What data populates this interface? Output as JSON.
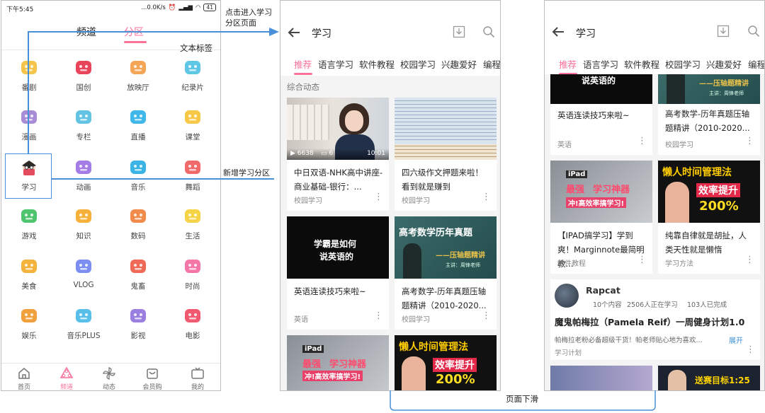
{
  "annotations": {
    "enter_line1": "点击进入学习",
    "enter_line2": "分区页面",
    "text_tag": "文本标签",
    "new_partition": "新增学习分区",
    "scroll_down": "页面下滑"
  },
  "phone1": {
    "status": {
      "time": "下午5:45",
      "net": "...0.0K/s",
      "battery": "41"
    },
    "tabs": [
      "频道",
      "分区"
    ],
    "grid": [
      "番剧",
      "国创",
      "放映厅",
      "纪录片",
      "漫画",
      "专栏",
      "直播",
      "课堂",
      "学习",
      "动画",
      "音乐",
      "舞蹈",
      "游戏",
      "知识",
      "数码",
      "生活",
      "美食",
      "VLOG",
      "鬼畜",
      "时尚",
      "娱乐",
      "音乐PLUS",
      "影视",
      "电影"
    ],
    "bottom_nav": [
      "首页",
      "频道",
      "动态",
      "会员购",
      "我的"
    ]
  },
  "phone2": {
    "title": "学习",
    "tabs": [
      "推荐",
      "语言学习",
      "软件教程",
      "校园学习",
      "兴趣爱好",
      "编程"
    ],
    "section": "综合动态",
    "cards": [
      {
        "title": "中日双语-NHK高中讲座-商业基础-银行：...",
        "tag": "校园学习",
        "views": "6638",
        "danmaku": "6",
        "duration": "10:01"
      },
      {
        "title": "四六级作文押题来啦！看到就是赚到",
        "tag": "校园学习"
      },
      {
        "title": "英语连读技巧来啦~",
        "tag": "英语",
        "thumb_l1": "学霸是如何",
        "thumb_l2": "说英语的"
      },
      {
        "title": "高考数学-历年真题压轴题精讲（2010-2020...",
        "tag": "校园学习",
        "thumb_l1": "高考数学历年真题",
        "thumb_l2": "——压轴题精讲",
        "thumb_l3": "主讲：周锋老师"
      },
      {
        "thumb_l1": "iPad",
        "thumb_l2": "最强",
        "thumb_l3": "学习神器",
        "thumb_l4": "冲!高效率搞学习!"
      },
      {
        "thumb_l1": "懒人时间管理法",
        "thumb_l2": "效率提升",
        "thumb_l3": "200%"
      }
    ]
  },
  "phone3": {
    "title": "学习",
    "tabs": [
      "推荐",
      "语言学习",
      "软件教程",
      "校园学习",
      "兴趣爱好",
      "编程"
    ],
    "cards": [
      {
        "title": "英语连读技巧来啦~",
        "tag": "英语",
        "thumb": "说英语的"
      },
      {
        "title": "高考数学-历年真题压轴题精讲（2010-2020...",
        "tag": "校园学习",
        "thumb": "——压轴题精讲",
        "thumb2": "主讲：周锋老师"
      },
      {
        "title": "【IPAD搞学习】学到爽！Marginnote最简明教...",
        "tag": "软件教程",
        "thumb_l1": "iPad",
        "thumb_l2": "最强",
        "thumb_l3": "学习神器",
        "thumb_l4": "冲!高效率搞学习!"
      },
      {
        "title": "纯靠自律就是胡扯，人类天性就是懒惰",
        "tag": "学习方法",
        "thumb_l1": "懒人时间管理法",
        "thumb_l2": "效率提升",
        "thumb_l3": "200%"
      }
    ],
    "plan": {
      "user": "Rapcat",
      "meta1": "10个内容",
      "meta2": "2506人正在学习",
      "meta3": "103人已完成",
      "title": "魔鬼帕梅拉（Pamela Reif）一周健身计划1.0",
      "desc": "帕梅拉老粉必备超级干货！帕老师贴心地为喜欢...",
      "expand": "展开",
      "tag": "学习计划"
    },
    "bottom_thumb_text": "送赛目标1:25"
  },
  "colors": {
    "accent": "#fb7299",
    "annotation_line": "#4a90d9"
  }
}
